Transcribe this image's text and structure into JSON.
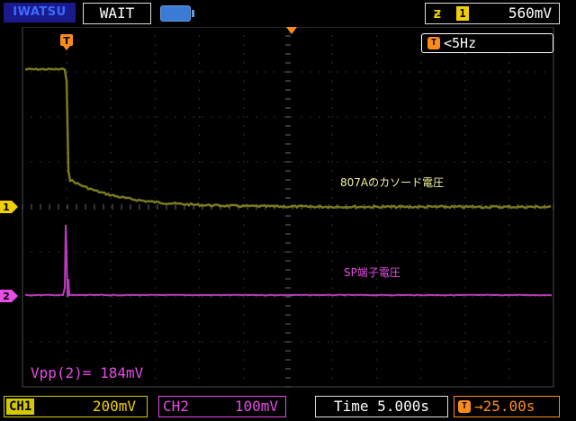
{
  "header": {
    "brand": "IWATSU",
    "status": "WAIT",
    "trigger": {
      "slope_symbol": "ƶ",
      "channel": "1",
      "level": "560mV"
    }
  },
  "screen": {
    "trigger_frequency": "<5Hz",
    "trigger_icon_letter": "T",
    "ch1_marker": "1",
    "ch2_marker": "2",
    "ch1_annotation": "807Aのカソード電圧",
    "ch2_annotation": "SP端子電圧",
    "measurement": "Vpp(2)= 184mV"
  },
  "footer": {
    "ch1_label": "CH1",
    "ch1_scale": "200mV",
    "ch2_label": "CH2",
    "ch2_scale": "100mV",
    "timebase": "Time 5.000s",
    "trigger_delay": "→25.00s"
  },
  "colors": {
    "ch1": "#7a7a1e",
    "ch2": "#b83ab8",
    "grid": "#4a4a4a",
    "trigger": "#ff8c1a"
  }
}
